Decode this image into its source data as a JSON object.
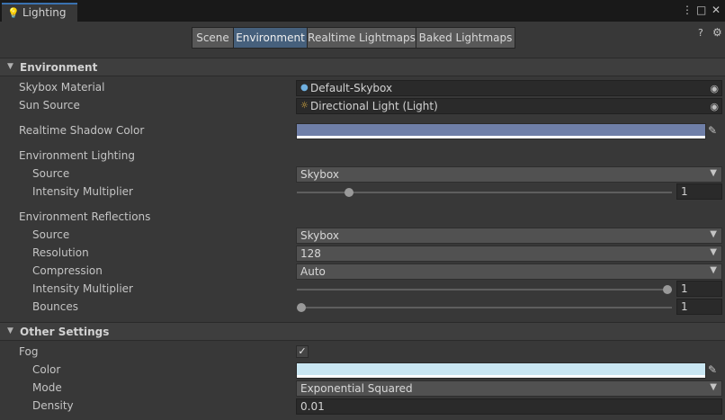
{
  "window": {
    "title": "Lighting",
    "icon": "lightbulb-icon",
    "controls": {
      "menu": "⋮",
      "maximize": "□",
      "close": "✕"
    }
  },
  "tabs": [
    {
      "label": "Scene",
      "active": false
    },
    {
      "label": "Environment",
      "active": true
    },
    {
      "label": "Realtime Lightmaps",
      "active": false
    },
    {
      "label": "Baked Lightmaps",
      "active": false
    }
  ],
  "header_icons": {
    "help": "?",
    "settings": "⚙"
  },
  "environment": {
    "section_title": "Environment",
    "skybox_material": {
      "label": "Skybox Material",
      "value": "Default-Skybox"
    },
    "sun_source": {
      "label": "Sun Source",
      "value": "Directional Light (Light)"
    },
    "realtime_shadow_color": {
      "label": "Realtime Shadow Color",
      "color": "#6f7fa8"
    },
    "environment_lighting": {
      "label": "Environment Lighting",
      "source": {
        "label": "Source",
        "value": "Skybox"
      },
      "intensity_multiplier": {
        "label": "Intensity Multiplier",
        "value": "1",
        "fraction": 0.13
      }
    },
    "environment_reflections": {
      "label": "Environment Reflections",
      "source": {
        "label": "Source",
        "value": "Skybox"
      },
      "resolution": {
        "label": "Resolution",
        "value": "128"
      },
      "compression": {
        "label": "Compression",
        "value": "Auto"
      },
      "intensity_multiplier": {
        "label": "Intensity Multiplier",
        "value": "1",
        "fraction": 1.0
      },
      "bounces": {
        "label": "Bounces",
        "value": "1",
        "fraction": 0.0
      }
    }
  },
  "other_settings": {
    "section_title": "Other Settings",
    "fog": {
      "label": "Fog",
      "checked": true
    },
    "color": {
      "label": "Color",
      "color": "#c9e6f2"
    },
    "mode": {
      "label": "Mode",
      "value": "Exponential Squared"
    },
    "density": {
      "label": "Density",
      "value": "0.01"
    }
  }
}
